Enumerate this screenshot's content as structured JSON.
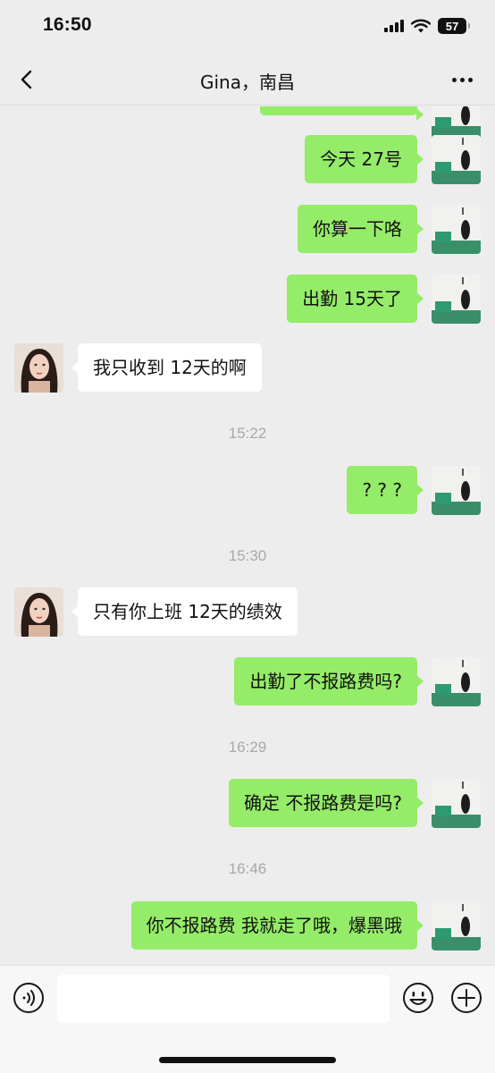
{
  "status_bar": {
    "time": "16:50",
    "battery": "57"
  },
  "header": {
    "title": "Gina，南昌"
  },
  "messages": [
    {
      "side": "right",
      "text": "今天 27号"
    },
    {
      "side": "right",
      "text": "你算一下咯"
    },
    {
      "side": "right",
      "text": "出勤 15天了"
    },
    {
      "side": "left",
      "text": "我只收到 12天的啊"
    },
    {
      "time": "15:22"
    },
    {
      "side": "right",
      "text": "? ? ?"
    },
    {
      "time": "15:30"
    },
    {
      "side": "left",
      "text": "只有你上班 12天的绩效"
    },
    {
      "side": "right",
      "text": "出勤了不报路费吗?"
    },
    {
      "time": "16:29"
    },
    {
      "side": "right",
      "text": "确定 不报路费是吗?"
    },
    {
      "time": "16:46"
    },
    {
      "side": "right",
      "text": "你不报路费 我就走了哦，爆黑哦"
    }
  ],
  "input": {
    "value": ""
  },
  "icons": {
    "back": "chevron-left-icon",
    "more": "more-icon",
    "voice": "voice-icon",
    "emoji": "emoji-icon",
    "plus": "plus-icon"
  },
  "colors": {
    "self_bubble": "#95ec69",
    "other_bubble": "#ffffff",
    "background": "#ededed"
  }
}
